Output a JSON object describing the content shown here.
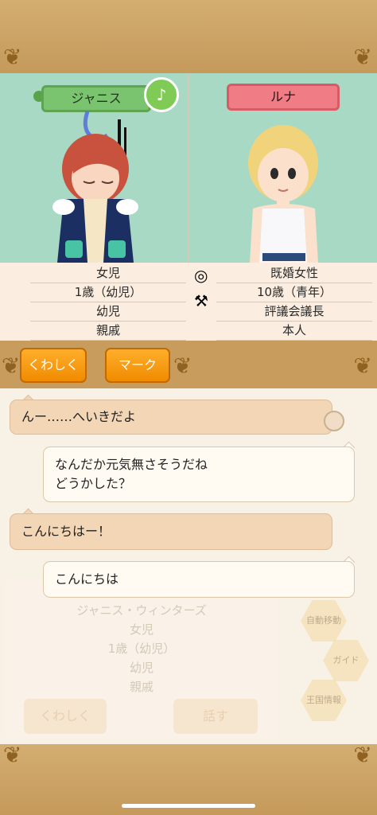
{
  "left_character": {
    "name": "ジャニス",
    "info": [
      "女児",
      "1歳（幼児）",
      "幼児",
      "親戚"
    ],
    "music_icon": "♪"
  },
  "right_character": {
    "name": "ルナ",
    "info": [
      "既婚女性",
      "10歳（青年）",
      "評議会議長",
      "本人"
    ]
  },
  "buttons": {
    "details": "くわしく",
    "mark": "マーク"
  },
  "chat": [
    {
      "side": "left",
      "text": "んー……へいきだよ"
    },
    {
      "side": "right",
      "lines": [
        "なんだか元気無さそうだね",
        "どうかした？"
      ]
    },
    {
      "side": "left",
      "text": "こんにちはー！"
    },
    {
      "side": "right",
      "text": "こんにちは"
    }
  ],
  "background_card": {
    "full_name": "ジャニス・ウィンターズ",
    "info": [
      "女児",
      "1歳（幼児）",
      "幼児",
      "親戚"
    ],
    "details_button": "くわしく",
    "talk_button": "話す",
    "menu_items": [
      "自動移動",
      "ガイド",
      "王国情報"
    ]
  },
  "colors": {
    "accent_orange": "#f39a12",
    "name_green": "#7ac36f",
    "name_red": "#f07d86",
    "panel_bg": "#a8d9c5"
  },
  "icons": [
    "ring-icon",
    "axe-icon",
    "music-note-icon",
    "pin-icon"
  ]
}
